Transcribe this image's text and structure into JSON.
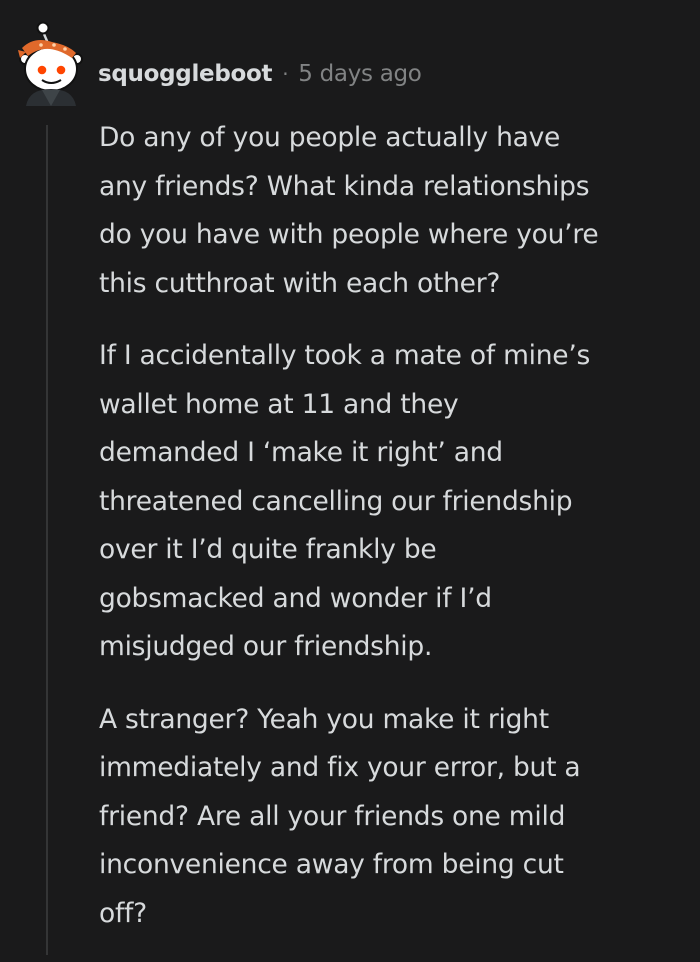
{
  "comment": {
    "author": "squoggleboot",
    "separator": "·",
    "timestamp": "5 days ago",
    "avatar_icon": "snoo-avatar-icon",
    "paragraphs": [
      [
        "Do any of you people actually have",
        "any friends? What kinda relationships",
        "do you have with people where you’re",
        "this cutthroat with each other?"
      ],
      [
        "If I accidentally took a mate of mine’s",
        "wallet home at 11 and they",
        "demanded I ‘make it right’ and",
        "threatened cancelling our friendship",
        "over it I’d quite frankly be",
        "gobsmacked and wonder if I’d",
        "misjudged our friendship."
      ],
      [
        "A stranger? Yeah you make it right",
        "immediately and fix your error, but a",
        "friend? Are all your friends one mild",
        "inconvenience away from being cut",
        "off?"
      ]
    ]
  },
  "colors": {
    "background": "#1a1a1b",
    "text": "#d7dadc",
    "meta": "#818384",
    "thread_line": "#343536"
  }
}
